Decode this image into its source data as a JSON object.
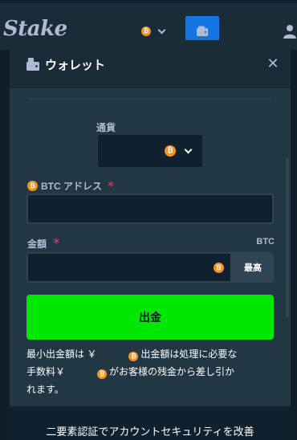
{
  "header": {
    "logo": "Stake",
    "currency_icon": "btc-coin-icon",
    "wallet_icon": "wallet-icon",
    "user_icon": "user-icon"
  },
  "modal": {
    "title": "ウォレット",
    "close_label": "✕",
    "currency": {
      "label": "通貨",
      "selected_icon": "btc-coin-icon"
    },
    "address": {
      "label": "BTC アドレス",
      "required_mark": "*",
      "value": ""
    },
    "amount": {
      "label": "金額",
      "required_mark": "*",
      "unit": "BTC",
      "value": "",
      "max_label": "最高"
    },
    "withdraw_label": "出金",
    "note": {
      "part1": "最小出金額は ￥",
      "part2": "出金額は処理に必要な",
      "part3": "手数料￥",
      "part4": "がお客様の残金から差し引か",
      "part5": "れます。"
    },
    "footer_text": "二要素認証でアカウントセキュリティを改善"
  },
  "coin_glyph": "₿",
  "colors": {
    "background": "#1a2c38",
    "panel": "#213743",
    "input": "#0f212e",
    "accent_green": "#00e701",
    "accent_blue": "#1475e1",
    "btc_orange": "#f7931a"
  }
}
